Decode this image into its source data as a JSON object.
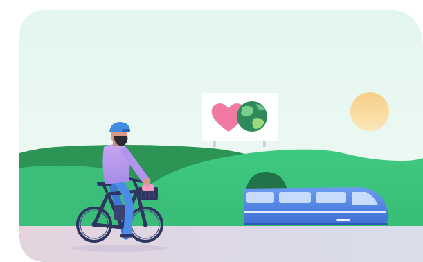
{
  "scene": {
    "subject": "cyclist-on-e-bike",
    "billboard_icons": [
      "heart-icon",
      "globe-icon"
    ],
    "train": "electric-commuter-train",
    "colors": {
      "sky_top": "#E3F5EE",
      "sky_bottom": "#F1FAF6",
      "hill_dark": "#2C9455",
      "hill_main": "#3CC47A",
      "hill_light": "#56D38C",
      "ground": "#DCD6E4",
      "sun": "#F9D79B",
      "heart": "#F07AA4",
      "globe_ocean": "#2E8A5A",
      "train_body": "#4F82E4",
      "jersey": "#B99CEC",
      "helmet": "#3F8CE0",
      "bike_frame": "#2D3560"
    }
  }
}
